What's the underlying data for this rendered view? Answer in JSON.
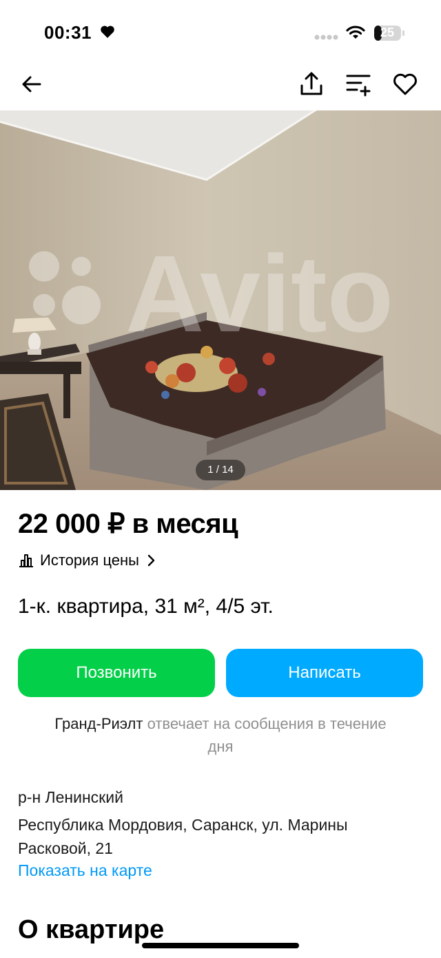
{
  "status_bar": {
    "time": "00:31",
    "battery": "25"
  },
  "toolbar": {
    "back_icon": "arrow-left-icon",
    "share_icon": "share-icon",
    "compare_icon": "compare-list-icon",
    "favorite_icon": "heart-outline-icon"
  },
  "photo": {
    "counter": "1 / 14",
    "watermark": "Avito"
  },
  "listing": {
    "price": "22 000 ₽ в месяц",
    "price_history_label": "История цены",
    "title": "1-к. квартира, 31 м², 4/5 эт."
  },
  "actions": {
    "call_label": "Позвонить",
    "write_label": "Написать"
  },
  "seller_note": {
    "agent": "Гранд-Риэлт",
    "text": " отвечает на сообщения в течение дня"
  },
  "location": {
    "district": "р-н Ленинский",
    "address": "Республика Мордовия, Саранск, ул. Марины Расковой, 21",
    "map_link": "Показать на карте"
  },
  "section": {
    "title": "О квартире"
  },
  "colors": {
    "call_button": "#04cf48",
    "write_button": "#00aaff",
    "link": "#0099f7",
    "muted_text": "#8f8f8f"
  }
}
